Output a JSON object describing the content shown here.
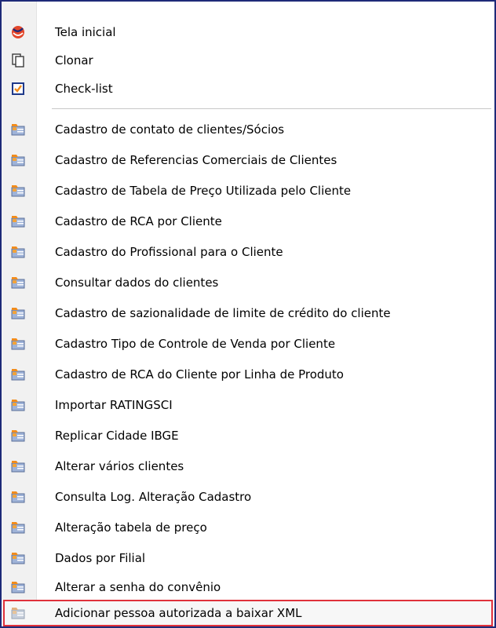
{
  "menu": {
    "top_items": [
      {
        "label": "Tela inicial",
        "icon": "home-swirl-icon"
      },
      {
        "label": "Clonar",
        "icon": "clone-pages-icon"
      },
      {
        "label": "Check-list",
        "icon": "checkbox-checked-icon"
      }
    ],
    "items": [
      {
        "label": "Cadastro de contato de clientes/Sócios",
        "icon": "form-icon"
      },
      {
        "label": "Cadastro de Referencias Comerciais de Clientes",
        "icon": "form-icon"
      },
      {
        "label": "Cadastro de Tabela de Preço Utilizada pelo Cliente",
        "icon": "form-icon"
      },
      {
        "label": "Cadastro de RCA por Cliente",
        "icon": "form-icon"
      },
      {
        "label": "Cadastro do Profissional para o Cliente",
        "icon": "form-icon"
      },
      {
        "label": "Consultar dados do clientes",
        "icon": "form-icon"
      },
      {
        "label": "Cadastro de sazionalidade de limite de crédito do cliente",
        "icon": "form-icon"
      },
      {
        "label": "Cadastro Tipo de Controle de Venda por Cliente",
        "icon": "form-icon"
      },
      {
        "label": "Cadastro de RCA do Cliente por Linha de Produto",
        "icon": "form-icon"
      },
      {
        "label": "Importar RATINGSCI",
        "icon": "form-icon"
      },
      {
        "label": "Replicar Cidade IBGE",
        "icon": "form-icon"
      },
      {
        "label": "Alterar vários clientes",
        "icon": "form-icon"
      },
      {
        "label": "Consulta Log. Alteração Cadastro",
        "icon": "form-icon"
      },
      {
        "label": "Alteração tabela de preço",
        "icon": "form-icon"
      },
      {
        "label": "Dados por Filial",
        "icon": "form-icon"
      },
      {
        "label": "Alterar a senha do convênio",
        "icon": "form-icon"
      },
      {
        "label": "Adicionar pessoa autorizada a baixar XML",
        "icon": "form-icon-disabled"
      }
    ]
  },
  "colors": {
    "border": "#1e2a78",
    "highlight_outline": "#e0313b",
    "checkbox_blue": "#1f3a8a",
    "check_orange": "#f28c1b"
  }
}
